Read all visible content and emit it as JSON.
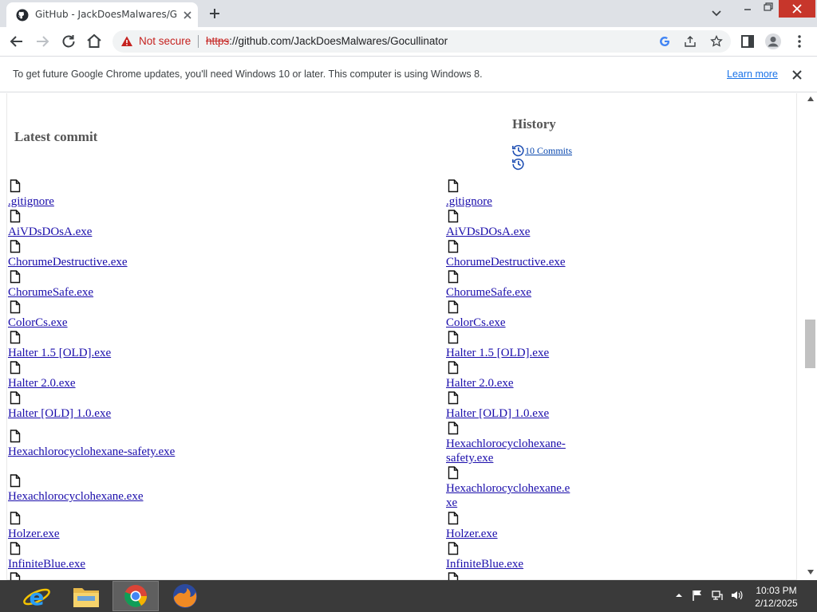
{
  "tab": {
    "title": "GitHub - JackDoesMalwares/Gocullinator"
  },
  "address": {
    "security_label": "Not secure",
    "url_scheme": "https",
    "url_rest": "://github.com/JackDoesMalwares/Gocullinator"
  },
  "infobar": {
    "message": "To get future Google Chrome updates, you'll need Windows 10 or later. This computer is using Windows 8.",
    "link": "Learn more"
  },
  "content": {
    "latest_commit_heading": "Latest commit",
    "history_heading": "History",
    "commits_link": "10 Commits",
    "files_left": [
      ".gitignore",
      "AiVDsDOsA.exe",
      "ChorumeDestructive.exe",
      "ChorumeSafe.exe",
      "ColorCs.exe",
      "Halter 1.5 [OLD].exe",
      "Halter 2.0.exe",
      "Halter [OLD] 1.0.exe",
      "Hexachlorocyclohexane-safety.exe",
      "Hexachlorocyclohexane.exe",
      "Holzer.exe",
      "InfiniteBlue.exe"
    ],
    "files_right": [
      ".gitignore",
      "AiVDsDOsA.exe",
      "ChorumeDestructive.exe",
      "ChorumeSafe.exe",
      "ColorCs.exe",
      "Halter 1.5 [OLD].exe",
      "Halter 2.0.exe",
      "Halter [OLD] 1.0.exe",
      "Hexachlorocyclohexane-",
      "safety.exe",
      "Hexachlorocyclohexane.e",
      "xe",
      "Holzer.exe",
      "InfiniteBlue.exe"
    ]
  },
  "taskbar": {
    "apps": [
      "internet-explorer",
      "file-explorer",
      "google-chrome",
      "firefox"
    ],
    "time": "10:03 PM",
    "date": "2/12/2025"
  },
  "colors": {
    "link": "#1a0dab",
    "taskbar": "#3a3a3a",
    "close_button": "#c7362b",
    "warning": "#c5221f"
  }
}
